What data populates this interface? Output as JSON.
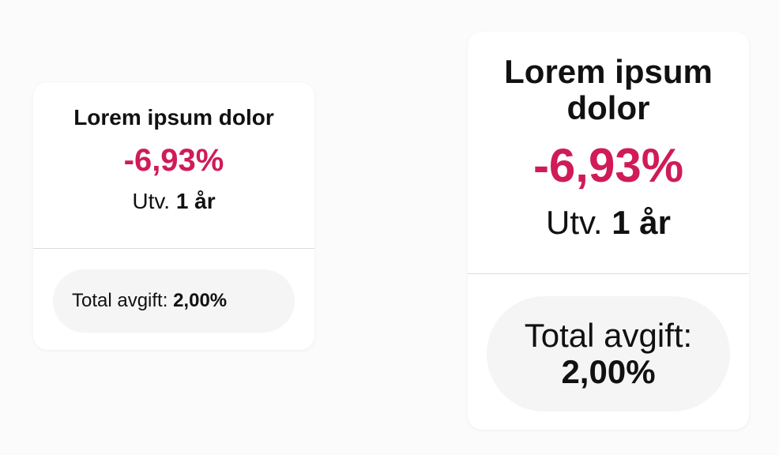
{
  "colors": {
    "background": "#fbfbfb",
    "card": "#ffffff",
    "negative_value": "#d01b58",
    "divider": "#dcdcdc",
    "pill": "#f5f5f5",
    "text": "#111111"
  },
  "cards": [
    {
      "title": "Lorem ipsum dolor",
      "value": "-6,93%",
      "period_label": "Utv.",
      "period_value": "1 år",
      "fee_label": "Total avgift:",
      "fee_value": "2,00%"
    },
    {
      "title": "Lorem ipsum dolor",
      "value": "-6,93%",
      "period_label": "Utv.",
      "period_value": "1 år",
      "fee_label": "Total avgift:",
      "fee_value": "2,00%"
    }
  ]
}
